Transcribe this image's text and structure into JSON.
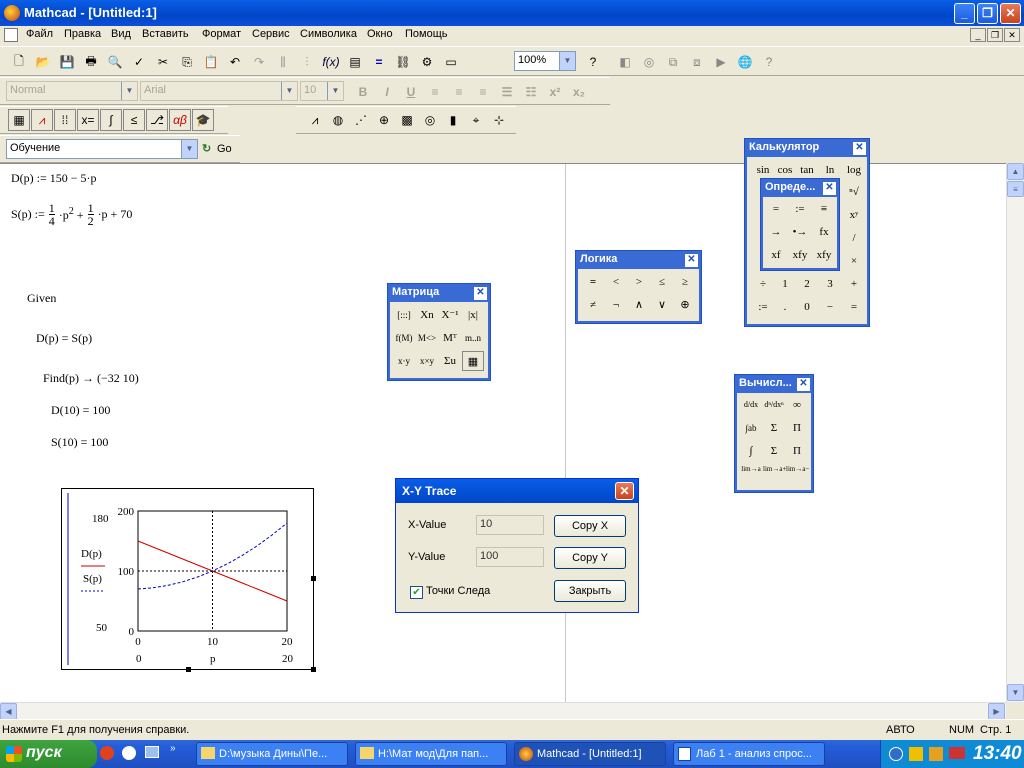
{
  "window": {
    "title": "Mathcad - [Untitled:1]"
  },
  "menu": [
    "Файл",
    "Правка",
    "Вид",
    "Вставить",
    "Формат",
    "Сервис",
    "Символика",
    "Окно",
    "Помощь"
  ],
  "toolbar": {
    "zoom": "100%",
    "style": "Normal",
    "font": "Arial",
    "size": "10",
    "resource": "Обучение",
    "go_label": "Go"
  },
  "worksheet": {
    "eq_D": "D(p) := 150 − 5·p",
    "eq_S_lhs": "S(p) :=",
    "given": "Given",
    "constraint": "D(p) = S(p)",
    "find": "Find(p) → (−32  10)",
    "d10": "D(10) = 100",
    "s10": "S(10) = 100"
  },
  "chart_data": {
    "type": "line",
    "x": [
      0,
      2,
      4,
      6,
      8,
      10,
      12,
      14,
      16,
      18,
      20
    ],
    "series": [
      {
        "name": "D(p)",
        "values": [
          150,
          140,
          130,
          120,
          110,
          100,
          90,
          80,
          70,
          60,
          50
        ],
        "color": "#cc0000"
      },
      {
        "name": "S(p)",
        "values": [
          70,
          72,
          76,
          82,
          90,
          100,
          112,
          126,
          142,
          160,
          180
        ],
        "color": "#0000cc"
      }
    ],
    "xlim": [
      0,
      20
    ],
    "ylim": [
      0,
      200
    ],
    "xticks": [
      "0",
      "10",
      "20"
    ],
    "yticks": [
      "0",
      "100",
      "200"
    ],
    "y_marker_top": "180",
    "y_marker_bottom": "50",
    "x_range_left": "0",
    "x_range_right": "20",
    "xlabel": "p",
    "trace_x": 10,
    "trace_y": 100
  },
  "palettes": {
    "calculator": {
      "title": "Калькулятор",
      "row1": [
        "sin",
        "cos",
        "tan",
        "ln",
        "log"
      ],
      "row5": [
        "÷",
        "1",
        "2",
        "3",
        "+"
      ],
      "row6": [
        ":=",
        ".",
        "0",
        "−",
        "="
      ]
    },
    "definition": {
      "title": "Опреде...",
      "buttons": [
        "=",
        ":=",
        "≡",
        "→",
        "•→",
        "fx",
        "xf",
        "xfy",
        "xfy"
      ]
    },
    "logic": {
      "title": "Логика",
      "buttons": [
        "=",
        "<",
        ">",
        "≤",
        "≥",
        "≠",
        "¬",
        "∧",
        "∨",
        "⊕"
      ]
    },
    "matrix": {
      "title": "Матрица",
      "buttons": [
        "[:::]",
        "Xn",
        "X⁻¹",
        "|x|",
        "f(M)",
        "M<>",
        "Mᵀ",
        "m..n",
        "x·y",
        "x×y",
        "Σu",
        "▦"
      ]
    },
    "calculus": {
      "title": "Вычисл...",
      "buttons": [
        "d/dx",
        "dⁿ/dxⁿ",
        "∞",
        "∫ab",
        "Σ",
        "Π",
        "∫",
        "Σ",
        "Π",
        "lim→a",
        "lim→a+",
        "lim→a−"
      ]
    }
  },
  "dialog": {
    "title": "X-Y Trace",
    "x_label": "X-Value",
    "x_value": "10",
    "y_label": "Y-Value",
    "y_value": "100",
    "copy_x": "Copy X",
    "copy_y": "Copy Y",
    "checkbox_label": "Точки Следа",
    "close_label": "Закрыть"
  },
  "status": {
    "help": "Нажмите F1 для получения справки.",
    "mode": "АВТО",
    "num": "NUM",
    "page": "Стр. 1"
  },
  "taskbar": {
    "start": "пуск",
    "tasks": [
      "D:\\музыка Дины\\Пе...",
      "H:\\Мат мод\\Для пап...",
      "Mathcad - [Untitled:1]",
      "Лаб 1 - анализ спрос..."
    ],
    "clock": "13:40"
  }
}
